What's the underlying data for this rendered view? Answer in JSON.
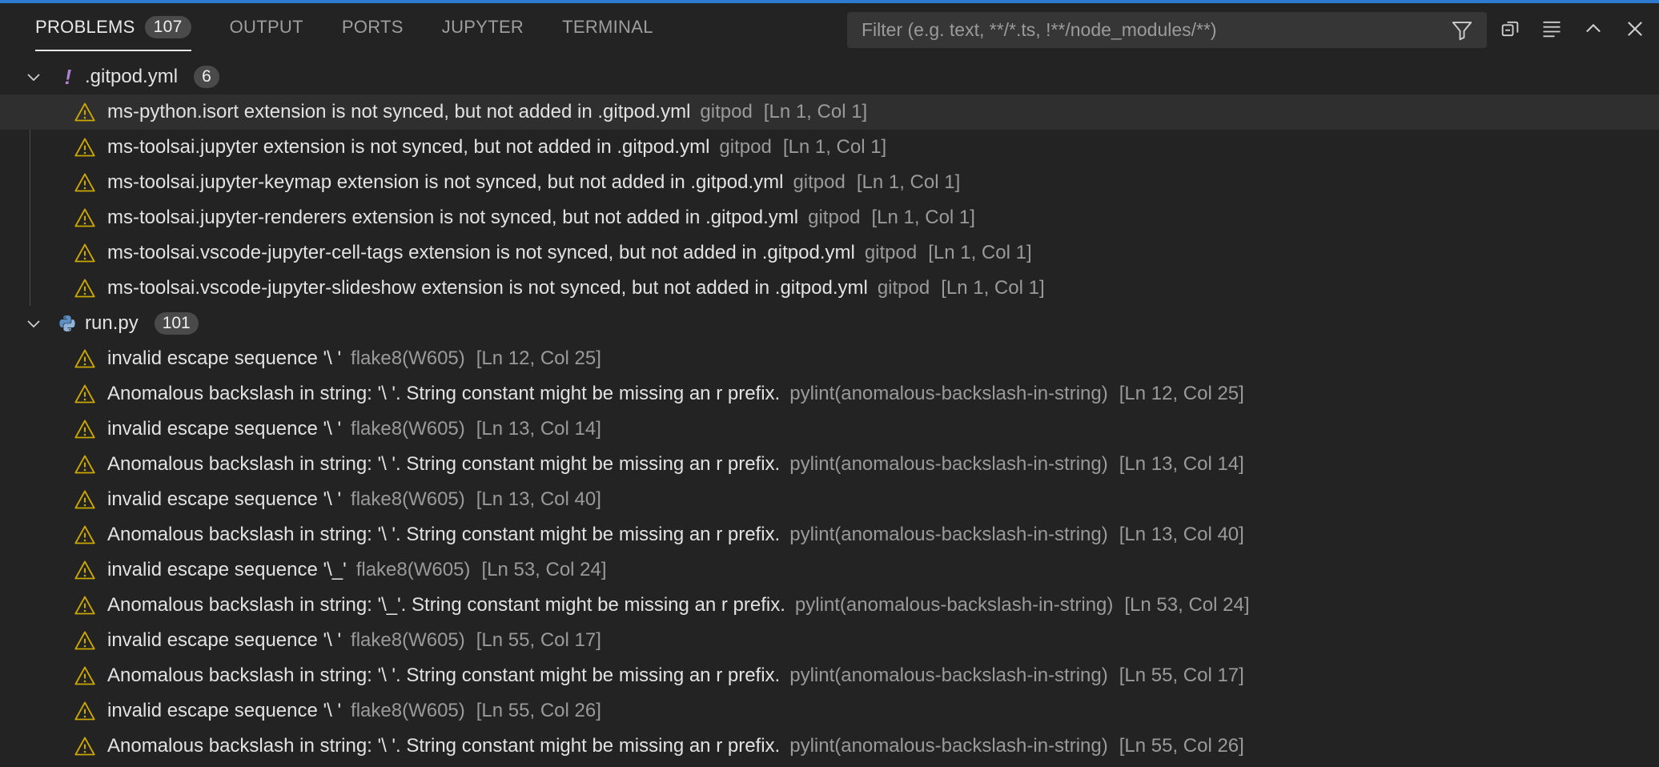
{
  "tabs": [
    {
      "label": "PROBLEMS",
      "count": "107",
      "active": true
    },
    {
      "label": "OUTPUT"
    },
    {
      "label": "PORTS"
    },
    {
      "label": "JUPYTER"
    },
    {
      "label": "TERMINAL"
    }
  ],
  "filter": {
    "placeholder": "Filter (e.g. text, **/*.ts, !**/node_modules/**)",
    "value": ""
  },
  "actions": [
    "filter-icon",
    "copy-icon",
    "wrap-icon",
    "chevron-up-icon",
    "close-icon"
  ],
  "colors": {
    "accent": "#2f7ad1",
    "warning": "#cca700",
    "background": "#232323",
    "selected": "#2f2f2f"
  },
  "groups": [
    {
      "name": ".gitpod.yml",
      "count": "6",
      "icon": "exclamation-icon",
      "problems": [
        {
          "message": "ms-python.isort extension is not synced, but not added in .gitpod.yml",
          "source": "gitpod",
          "location": "[Ln 1, Col 1]"
        },
        {
          "message": "ms-toolsai.jupyter extension is not synced, but not added in .gitpod.yml",
          "source": "gitpod",
          "location": "[Ln 1, Col 1]"
        },
        {
          "message": "ms-toolsai.jupyter-keymap extension is not synced, but not added in .gitpod.yml",
          "source": "gitpod",
          "location": "[Ln 1, Col 1]"
        },
        {
          "message": "ms-toolsai.jupyter-renderers extension is not synced, but not added in .gitpod.yml",
          "source": "gitpod",
          "location": "[Ln 1, Col 1]"
        },
        {
          "message": "ms-toolsai.vscode-jupyter-cell-tags extension is not synced, but not added in .gitpod.yml",
          "source": "gitpod",
          "location": "[Ln 1, Col 1]"
        },
        {
          "message": "ms-toolsai.vscode-jupyter-slideshow extension is not synced, but not added in .gitpod.yml",
          "source": "gitpod",
          "location": "[Ln 1, Col 1]"
        }
      ]
    },
    {
      "name": "run.py",
      "count": "101",
      "icon": "python-icon",
      "problems": [
        {
          "message": "invalid escape sequence '\\ '",
          "source": "flake8(W605)",
          "location": "[Ln 12, Col 25]"
        },
        {
          "message": "Anomalous backslash in string: '\\ '. String constant might be missing an r prefix.",
          "source": "pylint(anomalous-backslash-in-string)",
          "location": "[Ln 12, Col 25]"
        },
        {
          "message": "invalid escape sequence '\\ '",
          "source": "flake8(W605)",
          "location": "[Ln 13, Col 14]"
        },
        {
          "message": "Anomalous backslash in string: '\\ '. String constant might be missing an r prefix.",
          "source": "pylint(anomalous-backslash-in-string)",
          "location": "[Ln 13, Col 14]"
        },
        {
          "message": "invalid escape sequence '\\ '",
          "source": "flake8(W605)",
          "location": "[Ln 13, Col 40]"
        },
        {
          "message": "Anomalous backslash in string: '\\ '. String constant might be missing an r prefix.",
          "source": "pylint(anomalous-backslash-in-string)",
          "location": "[Ln 13, Col 40]"
        },
        {
          "message": "invalid escape sequence '\\_'",
          "source": "flake8(W605)",
          "location": "[Ln 53, Col 24]"
        },
        {
          "message": "Anomalous backslash in string: '\\_'. String constant might be missing an r prefix.",
          "source": "pylint(anomalous-backslash-in-string)",
          "location": "[Ln 53, Col 24]"
        },
        {
          "message": "invalid escape sequence '\\ '",
          "source": "flake8(W605)",
          "location": "[Ln 55, Col 17]"
        },
        {
          "message": "Anomalous backslash in string: '\\ '. String constant might be missing an r prefix.",
          "source": "pylint(anomalous-backslash-in-string)",
          "location": "[Ln 55, Col 17]"
        },
        {
          "message": "invalid escape sequence '\\ '",
          "source": "flake8(W605)",
          "location": "[Ln 55, Col 26]"
        },
        {
          "message": "Anomalous backslash in string: '\\ '. String constant might be missing an r prefix.",
          "source": "pylint(anomalous-backslash-in-string)",
          "location": "[Ln 55, Col 26]"
        }
      ]
    }
  ]
}
